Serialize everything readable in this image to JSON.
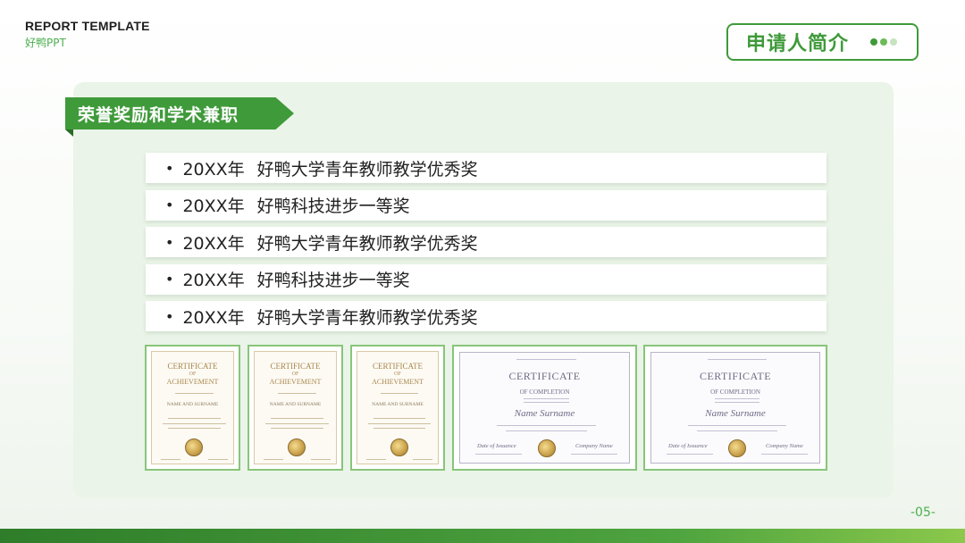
{
  "header": {
    "report_title": "REPORT TEMPLATE",
    "brand": "好鸭PPT",
    "badge_label": "申请人简介"
  },
  "section": {
    "title": "荣誉奖励和学术兼职"
  },
  "awards": [
    {
      "bullet": "•",
      "year": "20XX年",
      "name": "好鸭大学青年教师教学优秀奖"
    },
    {
      "bullet": "•",
      "year": "20XX年",
      "name": "好鸭科技进步一等奖"
    },
    {
      "bullet": "•",
      "year": "20XX年",
      "name": "好鸭大学青年教师教学优秀奖"
    },
    {
      "bullet": "•",
      "year": "20XX年",
      "name": "好鸭科技进步一等奖"
    },
    {
      "bullet": "•",
      "year": "20XX年",
      "name": "好鸭大学青年教师教学优秀奖"
    }
  ],
  "certificates": {
    "achievement": {
      "line1": "CERTIFICATE",
      "line2": "OF",
      "line3": "ACHIEVEMENT",
      "name": "NAME AND SURNAME"
    },
    "completion": {
      "title": "CERTIFICATE",
      "subtitle": "OF COMPLETION",
      "name": "Name Surname",
      "date_label": "Date of Issuance",
      "company_label": "Company Name"
    }
  },
  "footer": {
    "page_number": "-05-"
  },
  "colors": {
    "accent": "#3f9a3a",
    "panel": "#eaf4e8",
    "gold": "#a8874b",
    "purple": "#6f6a86"
  }
}
